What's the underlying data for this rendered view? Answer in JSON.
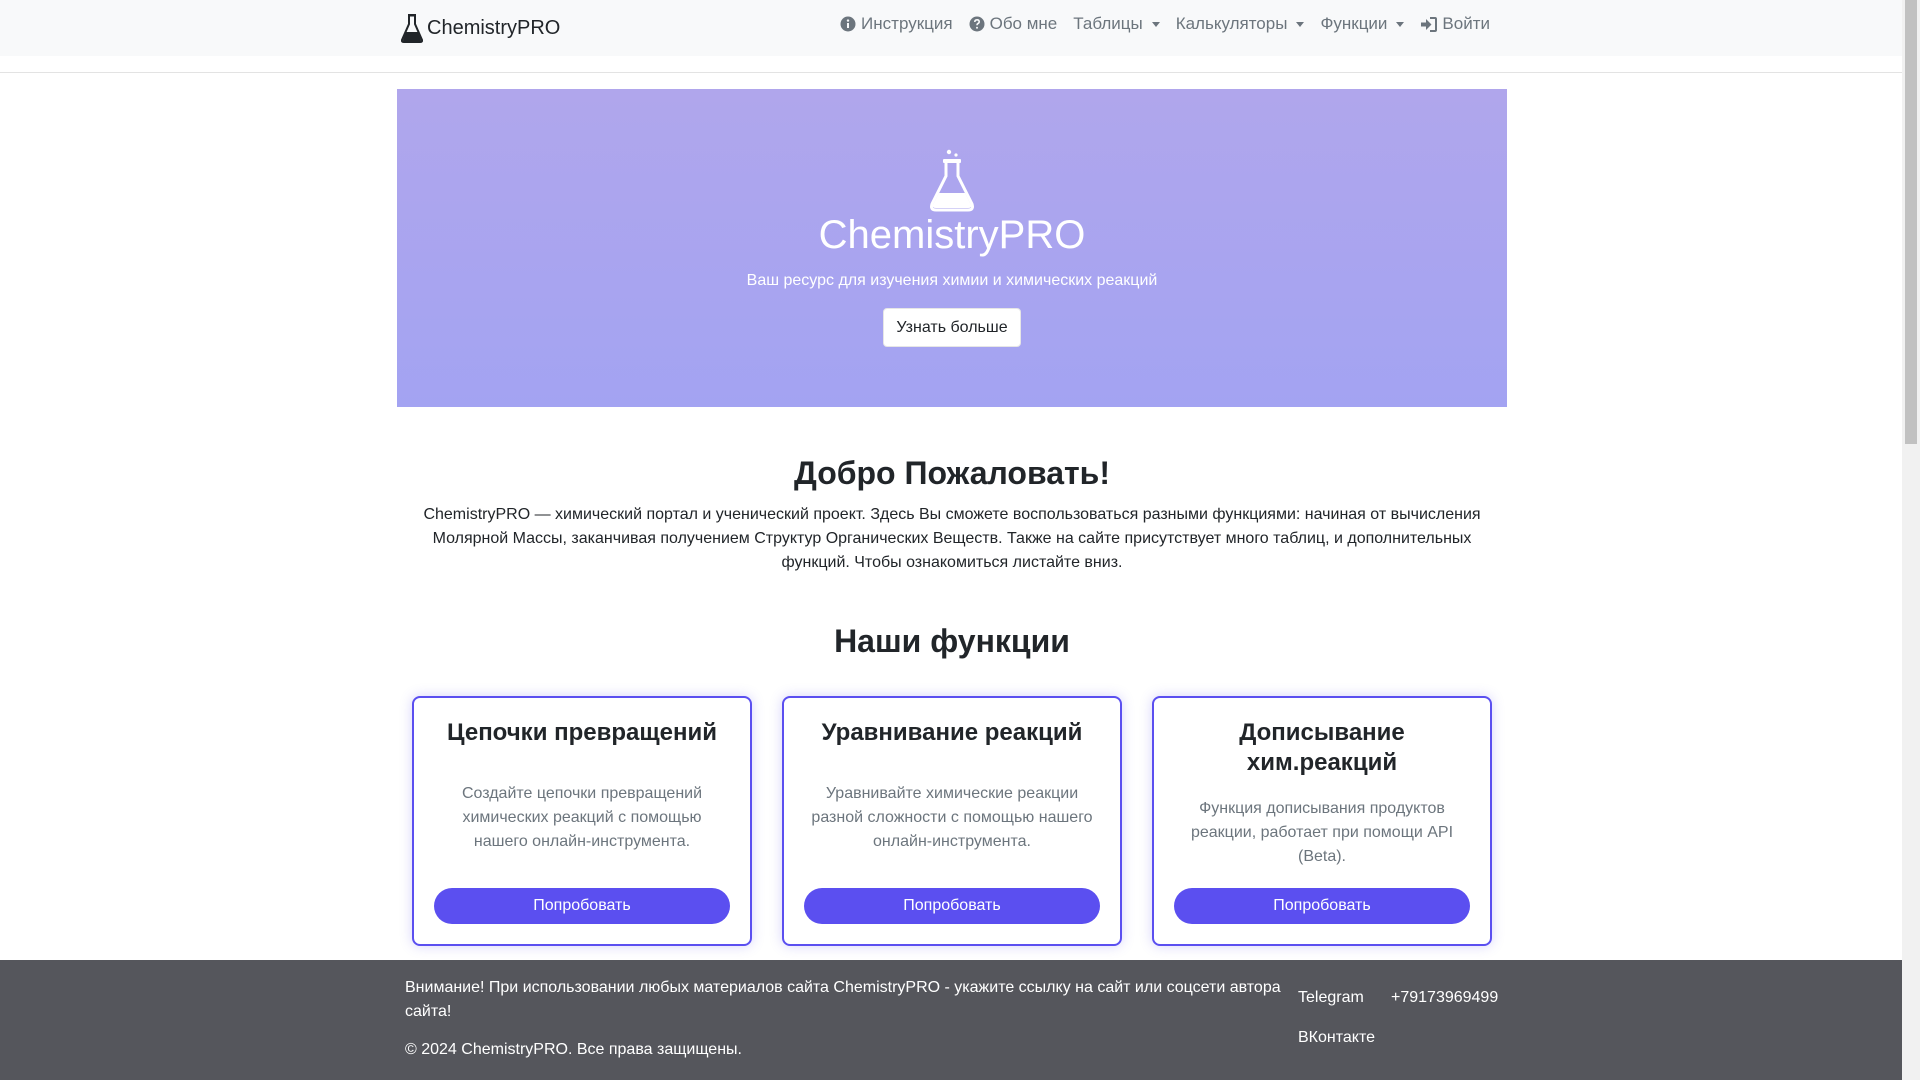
{
  "navbar": {
    "brand": "ChemistryPRO",
    "brand_icon": "flask-icon",
    "items": [
      {
        "label": "Инструкция",
        "icon": "info-circle-icon"
      },
      {
        "label": "Обо мне",
        "icon": "question-circle-icon"
      },
      {
        "label": "Таблицы",
        "dropdown": true
      },
      {
        "label": "Калькуляторы",
        "dropdown": true
      },
      {
        "label": "Функции",
        "dropdown": true
      },
      {
        "label": "Войти",
        "icon": "sign-in-icon"
      }
    ]
  },
  "hero": {
    "icon": "flask-icon",
    "title": "ChemistryPRO",
    "subtitle": "Ваш ресурс для изучения химии и химических реакций",
    "button": "Узнать больше",
    "gradient_top": "#b0a6ec",
    "gradient_bottom": "#a3a3f2"
  },
  "welcome": {
    "title": "Добро Пожаловать!",
    "text": "ChemistryPRO — химический портал и ученический проект. Здесь Вы сможете воспользоваться разными функциями: начиная от вычисления Молярной Массы, заканчивая получением Структур Органических Веществ. Также на сайте присутствует много таблиц, и дополнительных функций. Чтобы ознакомиться листайте вниз."
  },
  "features": {
    "title": "Наши функции",
    "cards": [
      {
        "title": "Цепочки превращений",
        "text": "Создайте цепочки превращений химических реакций с помощью нашего онлайн-инструмента.",
        "button": "Попробовать"
      },
      {
        "title": "Уравнивание реакций",
        "text": "Уравнивайте химические реакции разной сложности с помощью нашего онлайн-инструмента.",
        "button": "Попробовать"
      },
      {
        "title": "Дописывание хим.реакций",
        "text": "Функция дописывания продуктов реакции, работает при помощи API (Beta).",
        "button": "Попробовать"
      }
    ],
    "accent": "#5b4ff0"
  },
  "footer": {
    "warning": "Внимание! При использовании любых материалов сайта ChemistryPRO - укажите ссылку на сайт или соцсети автора сайта!",
    "copyright": "© 2024 ChemistryPRO. Все права защищены.",
    "telegram": "Telegram",
    "phone": "+79173969499",
    "vk": "ВКонтакте",
    "background": "#55565c"
  }
}
